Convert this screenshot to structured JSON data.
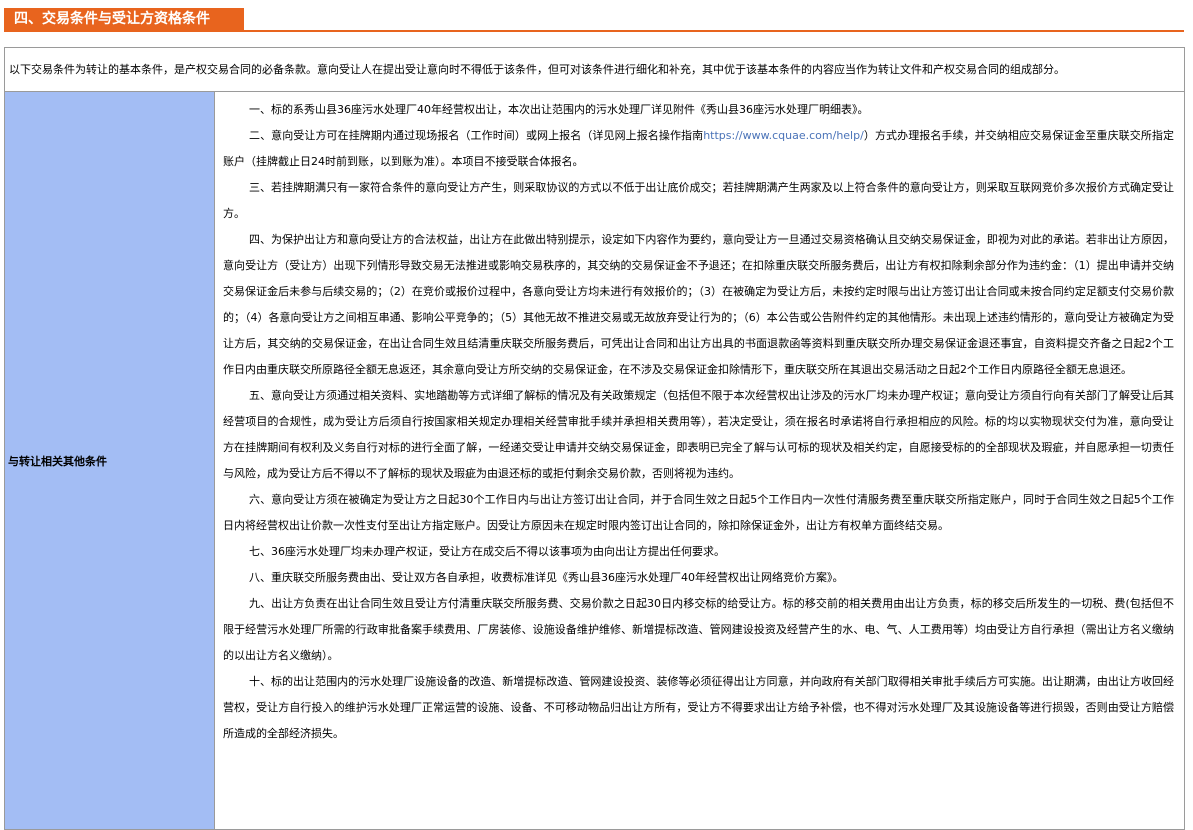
{
  "section": {
    "title": "四、交易条件与受让方资格条件"
  },
  "intro": "以下交易条件为转让的基本条件，是产权交易合同的必备条款。意向受让人在提出受让意向时不得低于该条件，但可对该条件进行细化和补充，其中优于该基本条件的内容应当作为转让文件和产权交易合同的组成部分。",
  "row": {
    "label": "与转让相关其他条件"
  },
  "paragraphs": {
    "p1": "一、标的系秀山县36座污水处理厂40年经营权出让，本次出让范围内的污水处理厂详见附件《秀山县36座污水处理厂明细表》。",
    "p2_before": "二、意向受让方可在挂牌期内通过现场报名（工作时间）或网上报名（详见网上报名操作指南",
    "p2_link": "https://www.cquae.com/help/",
    "p2_after": "）方式办理报名手续，并交纳相应交易保证金至重庆联交所指定账户（挂牌截止日24时前到账，以到账为准）。本项目不接受联合体报名。",
    "p3": "三、若挂牌期满只有一家符合条件的意向受让方产生，则采取协议的方式以不低于出让底价成交；若挂牌期满产生两家及以上符合条件的意向受让方，则采取互联网竞价多次报价方式确定受让方。",
    "p4": "四、为保护出让方和意向受让方的合法权益，出让方在此做出特别提示，设定如下内容作为要约，意向受让方一旦通过交易资格确认且交纳交易保证金，即视为对此的承诺。若非出让方原因，意向受让方（受让方）出现下列情形导致交易无法推进或影响交易秩序的，其交纳的交易保证金不予退还；在扣除重庆联交所服务费后，出让方有权扣除剩余部分作为违约金：（1）提出申请并交纳交易保证金后未参与后续交易的；（2）在竞价或报价过程中，各意向受让方均未进行有效报价的；（3）在被确定为受让方后，未按约定时限与出让方签订出让合同或未按合同约定足额支付交易价款的；（4）各意向受让方之间相互串通、影响公平竞争的；（5）其他无故不推进交易或无故放弃受让行为的；（6）本公告或公告附件约定的其他情形。未出现上述违约情形的，意向受让方被确定为受让方后，其交纳的交易保证金，在出让合同生效且结清重庆联交所服务费后，可凭出让合同和出让方出具的书面退款函等资料到重庆联交所办理交易保证金退还事宜，自资料提交齐备之日起2个工作日内由重庆联交所原路径全额无息返还，其余意向受让方所交纳的交易保证金，在不涉及交易保证金扣除情形下，重庆联交所在其退出交易活动之日起2个工作日内原路径全额无息退还。",
    "p5": "五、意向受让方须通过相关资料、实地踏勘等方式详细了解标的情况及有关政策规定（包括但不限于本次经营权出让涉及的污水厂均未办理产权证；意向受让方须自行向有关部门了解受让后其经营项目的合规性，成为受让方后须自行按国家相关规定办理相关经营审批手续并承担相关费用等），若决定受让，须在报名时承诺将自行承担相应的风险。标的均以实物现状交付为准，意向受让方在挂牌期间有权利及义务自行对标的进行全面了解，一经递交受让申请并交纳交易保证金，即表明已完全了解与认可标的现状及相关约定，自愿接受标的的全部现状及瑕疵，并自愿承担一切责任与风险，成为受让方后不得以不了解标的现状及瑕疵为由退还标的或拒付剩余交易价款，否则将视为违约。",
    "p6": "六、意向受让方须在被确定为受让方之日起30个工作日内与出让方签订出让合同，并于合同生效之日起5个工作日内一次性付清服务费至重庆联交所指定账户，同时于合同生效之日起5个工作日内将经营权出让价款一次性支付至出让方指定账户。因受让方原因未在规定时限内签订出让合同的，除扣除保证金外，出让方有权单方面终结交易。",
    "p7": "七、36座污水处理厂均未办理产权证，受让方在成交后不得以该事项为由向出让方提出任何要求。",
    "p8": "八、重庆联交所服务费由出、受让双方各自承担，收费标准详见《秀山县36座污水处理厂40年经营权出让网络竞价方案》。",
    "p9": "九、出让方负责在出让合同生效且受让方付清重庆联交所服务费、交易价款之日起30日内移交标的给受让方。标的移交前的相关费用由出让方负责，标的移交后所发生的一切税、费(包括但不限于经营污水处理厂所需的行政审批备案手续费用、厂房装修、设施设备维护维修、新增提标改造、管网建设投资及经营产生的水、电、气、人工费用等）均由受让方自行承担（需出让方名义缴纳的以出让方名义缴纳）。",
    "p10": "十、标的出让范围内的污水处理厂设施设备的改造、新增提标改造、管网建设投资、装修等必须征得出让方同意，并向政府有关部门取得相关审批手续后方可实施。出让期满，由出让方收回经营权，受让方自行投入的维护污水处理厂正常运营的设施、设备、不可移动物品归出让方所有，受让方不得要求出让方给予补偿，也不得对污水处理厂及其设施设备等进行损毁，否则由受让方赔偿所造成的全部经济损失。"
  }
}
